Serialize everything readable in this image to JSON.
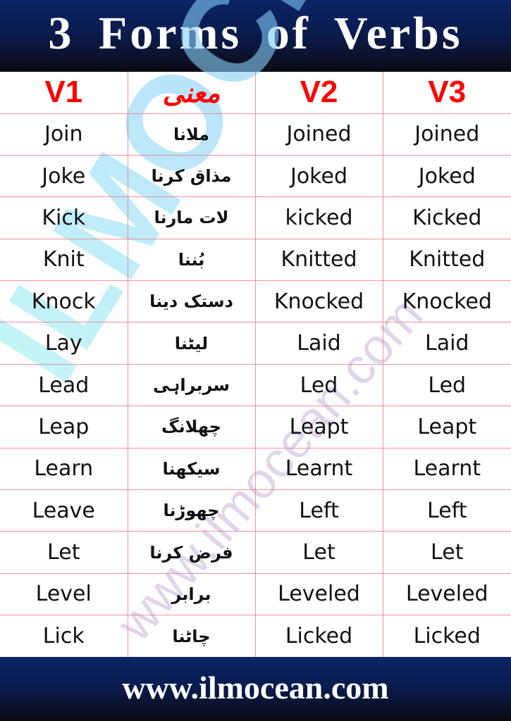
{
  "header": {
    "title": "3 Forms of Verbs"
  },
  "footer": {
    "website": "www.ilmocean.com"
  },
  "watermark": {
    "logo": "ILMOCEAN",
    "url": "www.ilmocean.com"
  },
  "colors": {
    "header_text_red": "#ff0000",
    "banner_navy": "#0b2365",
    "grid_line": "#f06e78"
  },
  "table": {
    "columns": [
      "V1",
      "معنی",
      "V2",
      "V3"
    ],
    "rows": [
      {
        "v1": "Join",
        "meaning": "ملانا",
        "v2": "Joined",
        "v3": "Joined"
      },
      {
        "v1": "Joke",
        "meaning": "مذاق کرنا",
        "v2": "Joked",
        "v3": "Joked"
      },
      {
        "v1": "Kick",
        "meaning": "لات مارنا",
        "v2": "kicked",
        "v3": "Kicked"
      },
      {
        "v1": "Knit",
        "meaning": "بُننا",
        "v2": "Knitted",
        "v3": "Knitted"
      },
      {
        "v1": "Knock",
        "meaning": "دستک دینا",
        "v2": "Knocked",
        "v3": "Knocked"
      },
      {
        "v1": "Lay",
        "meaning": "لیٹنا",
        "v2": "Laid",
        "v3": "Laid"
      },
      {
        "v1": "Lead",
        "meaning": "سربراہی",
        "v2": "Led",
        "v3": "Led"
      },
      {
        "v1": "Leap",
        "meaning": "چھلانگ",
        "v2": "Leapt",
        "v3": "Leapt"
      },
      {
        "v1": "Learn",
        "meaning": "سیکھنا",
        "v2": "Learnt",
        "v3": "Learnt"
      },
      {
        "v1": "Leave",
        "meaning": "چھوڑنا",
        "v2": "Left",
        "v3": "Left"
      },
      {
        "v1": "Let",
        "meaning": "فرض کرنا",
        "v2": "Let",
        "v3": "Let"
      },
      {
        "v1": "Level",
        "meaning": "برابر",
        "v2": "Leveled",
        "v3": "Leveled"
      },
      {
        "v1": "Lick",
        "meaning": "چاٹنا",
        "v2": "Licked",
        "v3": "Licked"
      }
    ]
  }
}
